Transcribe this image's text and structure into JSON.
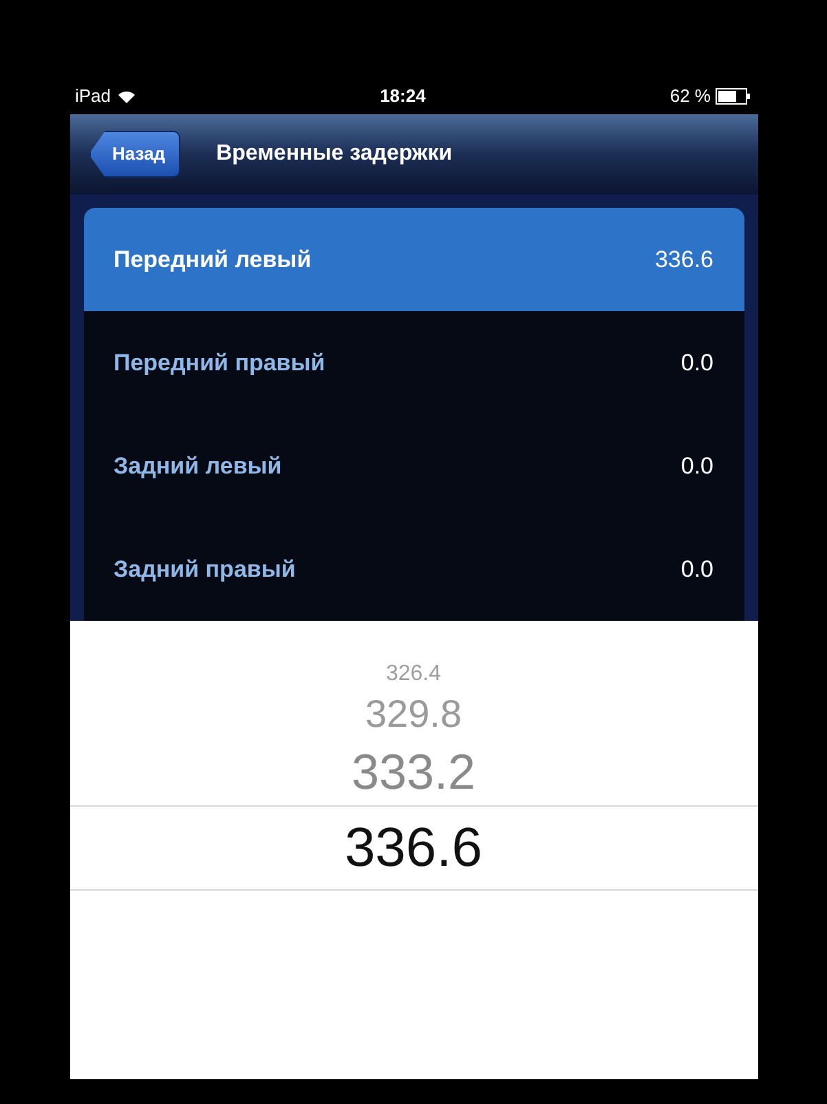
{
  "status_bar": {
    "device": "iPad",
    "time": "18:24",
    "battery": "62 %"
  },
  "nav": {
    "back": "Назад",
    "title": "Временные задержки"
  },
  "rows": [
    {
      "label": "Передний левый",
      "value": "336.6",
      "selected": true
    },
    {
      "label": "Передний правый",
      "value": "0.0",
      "selected": false
    },
    {
      "label": "Задний левый",
      "value": "0.0",
      "selected": false
    },
    {
      "label": "Задний правый",
      "value": "0.0",
      "selected": false
    }
  ],
  "picker": [
    {
      "value": "326.4",
      "selected": false
    },
    {
      "value": "329.8",
      "selected": false
    },
    {
      "value": "333.2",
      "selected": false
    },
    {
      "value": "336.6",
      "selected": true
    }
  ]
}
